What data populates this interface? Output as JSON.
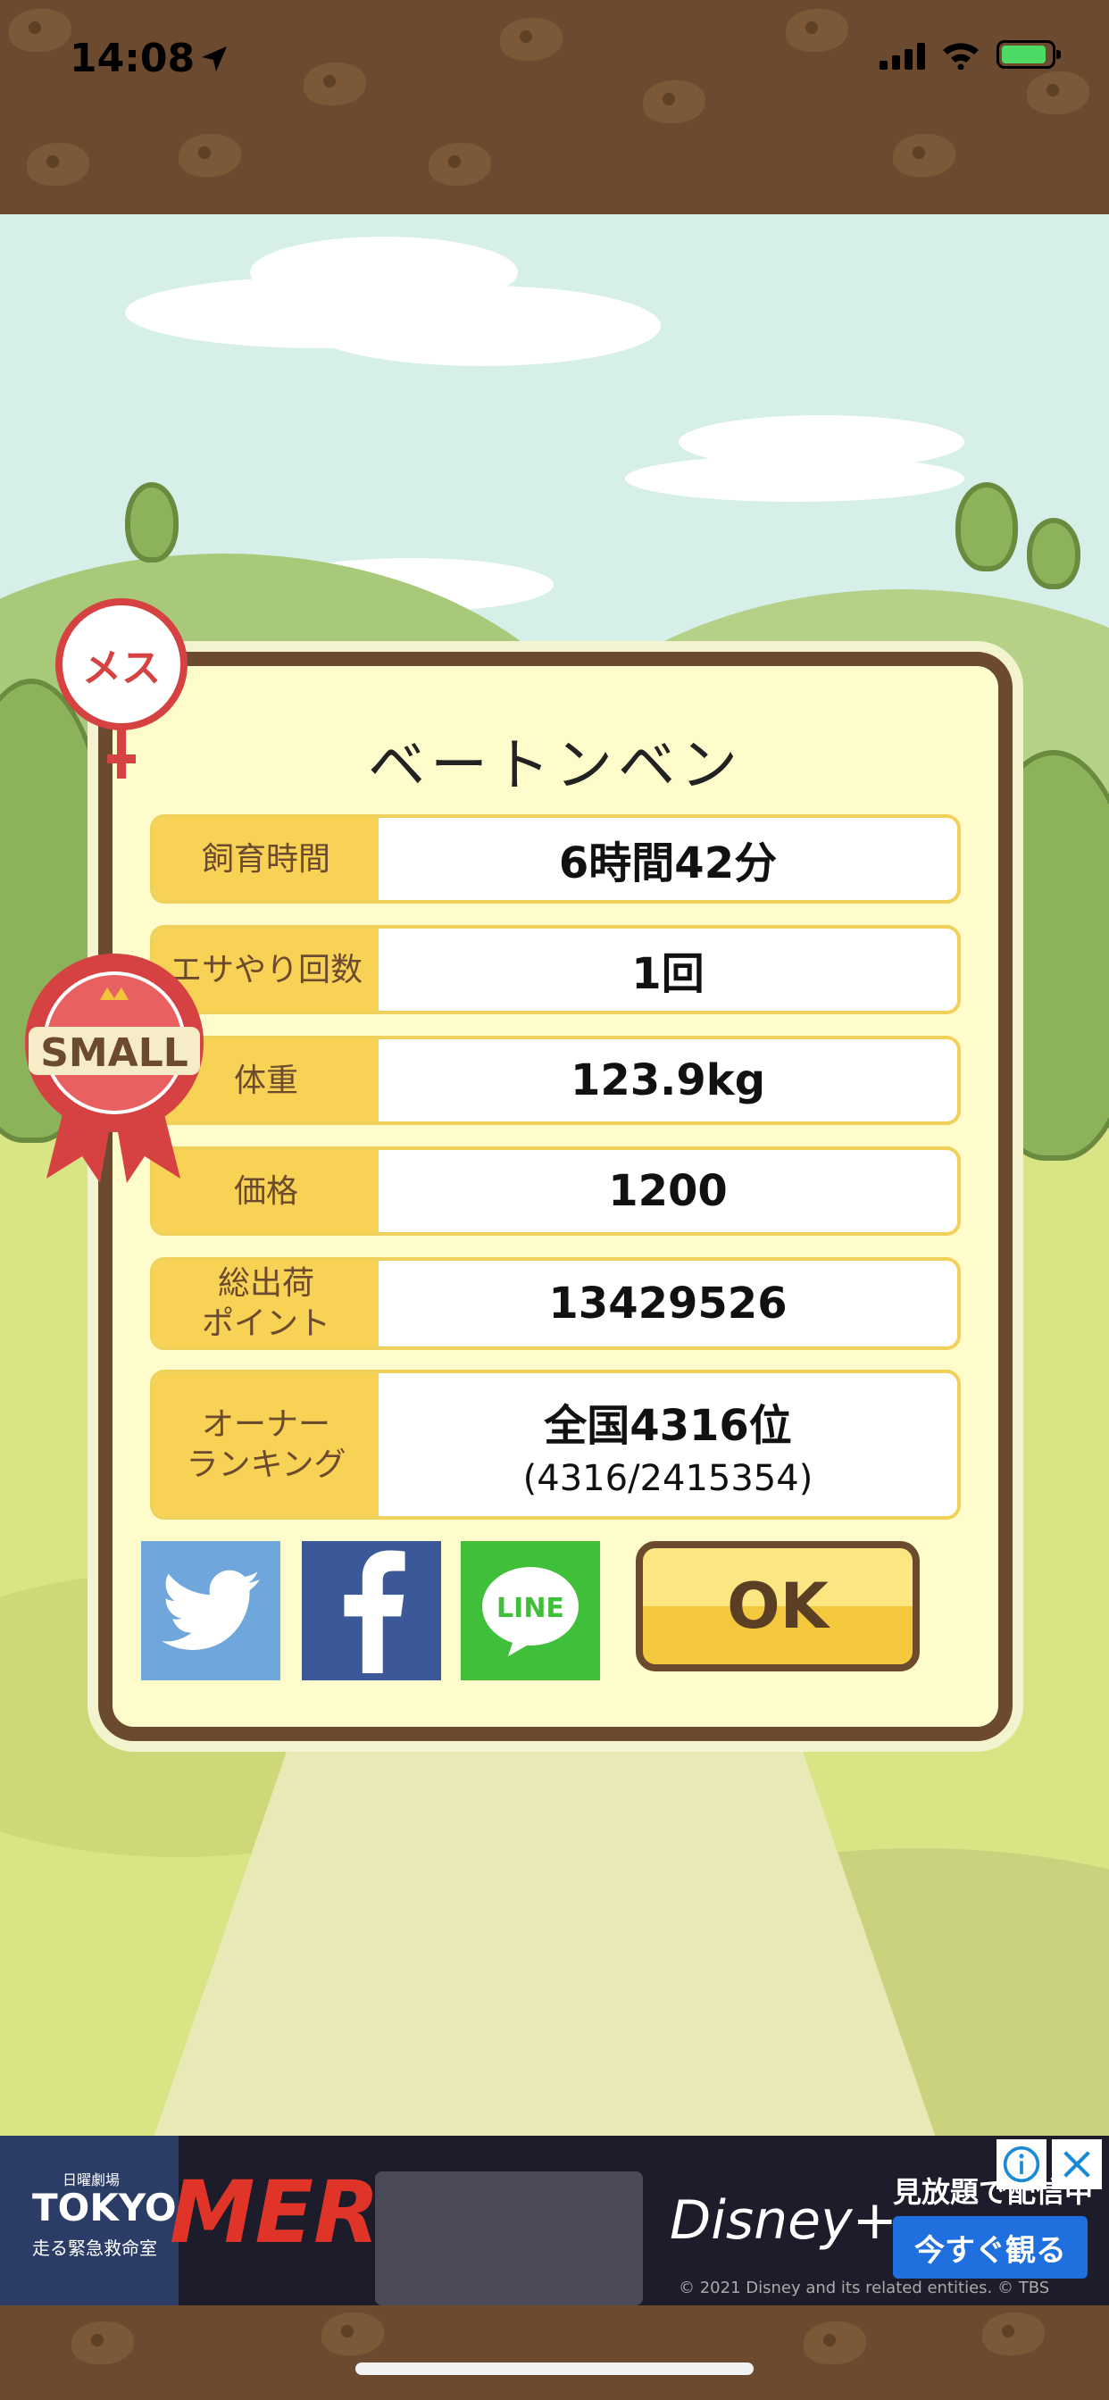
{
  "status": {
    "time": "14:08"
  },
  "pig": {
    "name": "ベートンベン",
    "gender_badge": "メス",
    "size_badge": "SMALL"
  },
  "stats": [
    {
      "label": "飼育時間",
      "value": "6時間42分"
    },
    {
      "label": "エサやり回数",
      "value": "1回"
    },
    {
      "label": "体重",
      "value": "123.9kg"
    },
    {
      "label": "価格",
      "value": "1200"
    },
    {
      "label": "総出荷\nポイント",
      "value": "13429526"
    },
    {
      "label": "オーナー\nランキング",
      "value": "全国4316位",
      "sub": "(4316/2415354)"
    }
  ],
  "social": {
    "twitter": "twitter-icon",
    "facebook": "facebook-icon",
    "line": "LINE"
  },
  "ok_label": "OK",
  "ad": {
    "left_text": "TOKYO",
    "small_text": "日曜劇場",
    "jp_sub": "走る緊急救命室",
    "title": "MER",
    "brand": "Disney+",
    "tag": "見放題で配信中",
    "cta": "今すぐ観る",
    "copyright": "© 2021 Disney and its related entities. © TBS"
  },
  "colors": {
    "brown": "#6b4a2f",
    "label_bg": "#f8d254",
    "dialog_bg": "#fffccb",
    "badge_red": "#d64242"
  }
}
